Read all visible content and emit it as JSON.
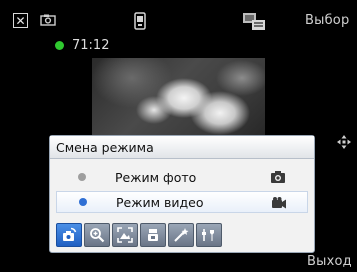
{
  "top_bar": {
    "close_glyph": "✕",
    "select_label": "Выбор",
    "timer": "71:12",
    "icons": [
      "close-icon",
      "camera-icon",
      "mode-icon",
      "storage-icon"
    ]
  },
  "popup": {
    "title": "Смена режима",
    "options": [
      {
        "label": "Режим фото",
        "selected": false,
        "icon": "photo-camera-icon"
      },
      {
        "label": "Режим видео",
        "selected": true,
        "icon": "video-camera-icon"
      }
    ],
    "toolbar": [
      "mode-change-icon",
      "zoom-icon",
      "scene-icon",
      "flash-icon",
      "effects-icon",
      "settings-icon"
    ]
  },
  "bottom_bar": {
    "exit_label": "Выход"
  },
  "colors": {
    "status_green": "#2fc82f",
    "selected_radio": "#2f6fd4",
    "active_tool": "#1f5fc2"
  }
}
